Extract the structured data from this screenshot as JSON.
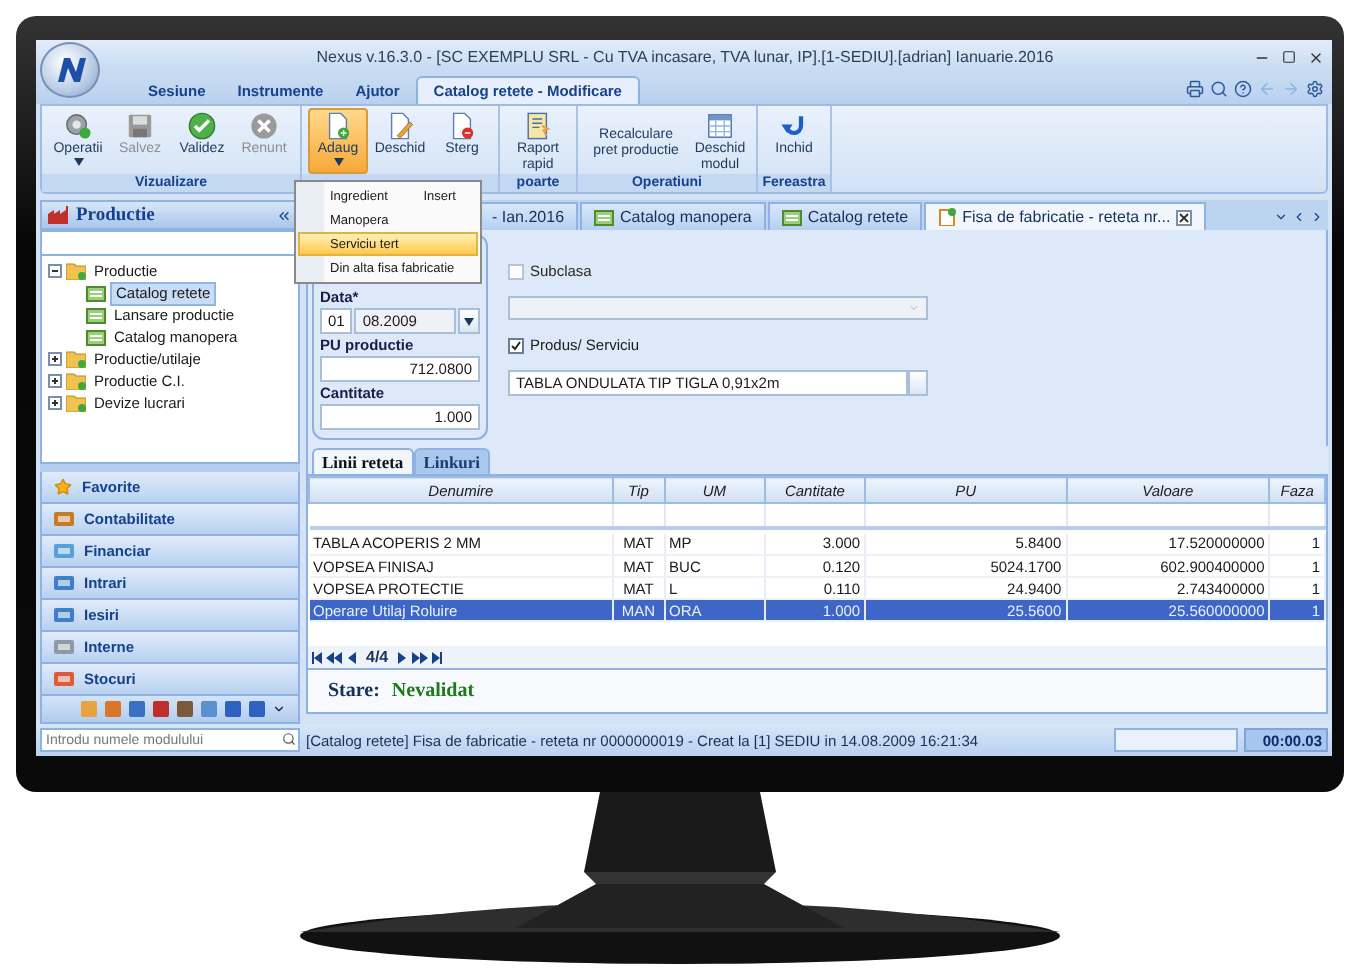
{
  "window": {
    "title": "Nexus v.16.3.0 - [SC EXEMPLU SRL - Cu TVA incasare, TVA lunar, IP].[1-SEDIU].[adrian] Ianuarie.2016"
  },
  "menu_tabs": [
    {
      "label": "Sesiune",
      "selected": false
    },
    {
      "label": "Instrumente",
      "selected": false
    },
    {
      "label": "Ajutor",
      "selected": false
    },
    {
      "label": "Catalog retete -  Modificare",
      "selected": true
    }
  ],
  "ribbon_groups": [
    {
      "label": "Vizualizare",
      "buttons": [
        {
          "label": "Operatii",
          "disabled": false,
          "pressed": false,
          "dropdown": true
        },
        {
          "label": "Salvez",
          "disabled": true,
          "pressed": false,
          "dropdown": false
        },
        {
          "label": "Validez",
          "disabled": false,
          "pressed": false,
          "dropdown": false
        },
        {
          "label": "Renunt",
          "disabled": true,
          "pressed": false,
          "dropdown": false
        }
      ]
    },
    {
      "buttons": [
        {
          "label": "Adaug",
          "disabled": false,
          "pressed": true,
          "dropdown": true
        },
        {
          "label": "Deschid",
          "disabled": false,
          "pressed": false,
          "dropdown": false
        },
        {
          "label": "Sterg",
          "disabled": false,
          "pressed": false,
          "dropdown": false
        }
      ]
    },
    {
      "label": "poarte",
      "buttons": [
        {
          "label": "Raport rapid",
          "disabled": false,
          "pressed": false,
          "dropdown": false
        }
      ]
    },
    {
      "label": "Operatiuni",
      "buttons": [
        {
          "label": "Recalculare pret productie",
          "disabled": false,
          "pressed": false,
          "dropdown": false
        },
        {
          "label": "Deschid modul",
          "disabled": false,
          "pressed": false,
          "dropdown": false
        }
      ]
    },
    {
      "label": "Fereastra",
      "buttons": [
        {
          "label": "Inchid",
          "disabled": false,
          "pressed": false,
          "dropdown": false
        }
      ]
    }
  ],
  "dropdown_menu": {
    "items": [
      {
        "label": "Ingredient",
        "shortcut": "Insert",
        "selected": false
      },
      {
        "label": "Manopera",
        "selected": false
      },
      {
        "label": "Serviciu tert",
        "selected": true
      },
      {
        "label": "Din alta fisa fabricatie",
        "selected": false
      }
    ]
  },
  "sidebar": {
    "title": "Productie",
    "tree": [
      {
        "label": "Productie",
        "expanded": true,
        "selected": false,
        "children": [
          {
            "label": "Catalog retete",
            "selected": true
          },
          {
            "label": "Lansare productie",
            "selected": false
          },
          {
            "label": "Catalog manopera",
            "selected": false
          }
        ]
      },
      {
        "label": "Productie/utilaje",
        "expanded": false,
        "selected": false
      },
      {
        "label": "Productie C.I.",
        "expanded": false,
        "selected": false
      },
      {
        "label": "Devize lucrari",
        "expanded": false,
        "selected": false
      }
    ],
    "nav": [
      {
        "label": "Favorite"
      },
      {
        "label": "Contabilitate"
      },
      {
        "label": "Financiar"
      },
      {
        "label": "Intrari"
      },
      {
        "label": "Iesiri"
      },
      {
        "label": "Interne"
      },
      {
        "label": "Stocuri"
      }
    ]
  },
  "doc_tabs": [
    {
      "label": "- Ian.2016",
      "selected": false
    },
    {
      "label": "Catalog manopera",
      "selected": false
    },
    {
      "label": "Catalog retete",
      "selected": false
    },
    {
      "label": "Fisa de fabricatie - reteta nr...",
      "selected": true
    }
  ],
  "form": {
    "date": {
      "label": "Data*",
      "day": "01",
      "value": "08.2009"
    },
    "pu": {
      "label": "PU productie",
      "value": "712.0800"
    },
    "qty": {
      "label": "Cantitate",
      "value": "1.000"
    },
    "subclasa": {
      "label": "Subclasa",
      "checked": false
    },
    "produs": {
      "label": "Produs/ Serviciu",
      "checked": true
    },
    "product": {
      "value": "TABLA ONDULATA TIP TIGLA 0,91x2m"
    }
  },
  "detail_tabs": [
    {
      "label": "Linii reteta",
      "selected": true
    },
    {
      "label": "Linkuri",
      "selected": false
    }
  ],
  "table": {
    "columns": [
      "Denumire",
      "Tip",
      "UM",
      "Cantitate",
      "PU",
      "Valoare",
      "Faza"
    ],
    "rows": [
      {
        "cells": [
          "TABLA ACOPERIS 2 MM",
          "MAT",
          "MP",
          "3.000",
          "5.8400",
          "17.520000000",
          "1"
        ],
        "selected": false
      },
      {
        "cells": [
          "VOPSEA FINISAJ",
          "MAT",
          "BUC",
          "0.120",
          "5024.1700",
          "602.900400000",
          "1"
        ],
        "selected": false
      },
      {
        "cells": [
          "VOPSEA PROTECTIE",
          "MAT",
          "L",
          "0.110",
          "24.9400",
          "2.743400000",
          "1"
        ],
        "selected": false
      },
      {
        "cells": [
          "Operare Utilaj Roluire",
          "MAN",
          "ORA",
          "1.000",
          "25.5600",
          "25.560000000",
          "1"
        ],
        "selected": true
      }
    ],
    "pager": "4/4"
  },
  "state": {
    "label": "Stare:",
    "value": "Nevalidat"
  },
  "status_bar": {
    "module_search": {
      "placeholder": "Introdu numele modulului"
    },
    "text": "[Catalog retete] Fisa de fabricatie - reteta nr 0000000019 - Creat la [1] SEDIU  in 14.08.2009 16:21:34",
    "timer": "00:00.03"
  }
}
